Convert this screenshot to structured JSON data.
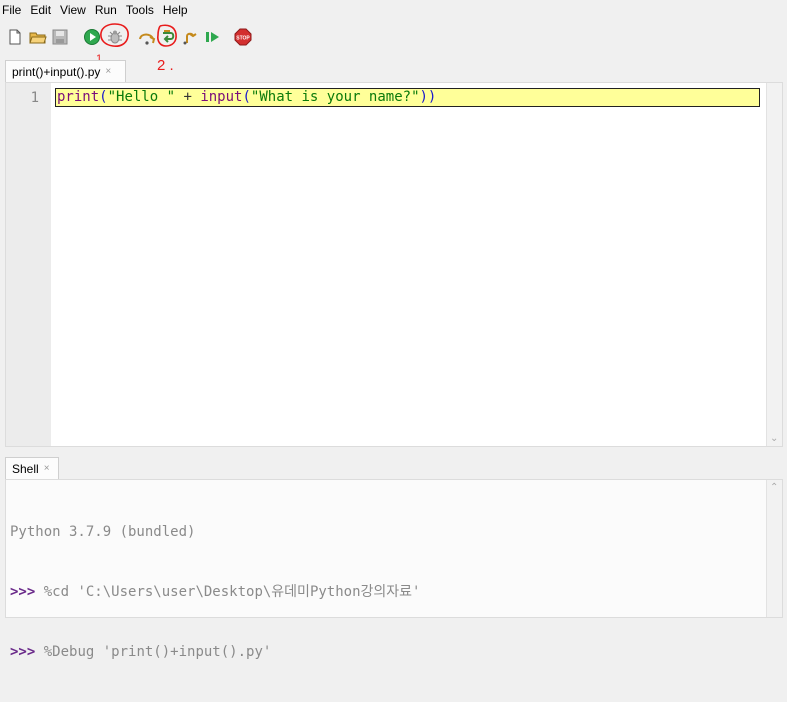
{
  "menu": [
    "File",
    "Edit",
    "View",
    "Run",
    "Tools",
    "Help"
  ],
  "toolbar": {
    "icons": [
      "new-file-icon",
      "open-folder-icon",
      "save-icon",
      "run-icon",
      "debug-icon",
      "step-over-icon",
      "step-into-icon",
      "step-out-icon",
      "resume-icon",
      "stop-icon"
    ],
    "stop_label": "STOP"
  },
  "annotations": {
    "label_1": "1.",
    "label_2": "2 .",
    "color": "#e81c1c"
  },
  "editor": {
    "tab_label": "print()+input().py",
    "tab_close": "×",
    "line_number": "1",
    "code": {
      "fn1": "print",
      "p1": "(",
      "s1": "\"Hello \"",
      "op": " + ",
      "fn2": "input",
      "p2": "(",
      "s2": "\"What is your name?\"",
      "p3": "))"
    }
  },
  "shell": {
    "tab_label": "Shell",
    "tab_close": "×",
    "lines": [
      {
        "prompt": "",
        "text": "Python 3.7.9 (bundled)"
      },
      {
        "prompt": ">>>",
        "text": " %cd 'C:\\Users\\user\\Desktop\\유데미Python강의자료'"
      },
      {
        "prompt": ">>>",
        "text": " %Debug 'print()+input().py'"
      }
    ]
  }
}
